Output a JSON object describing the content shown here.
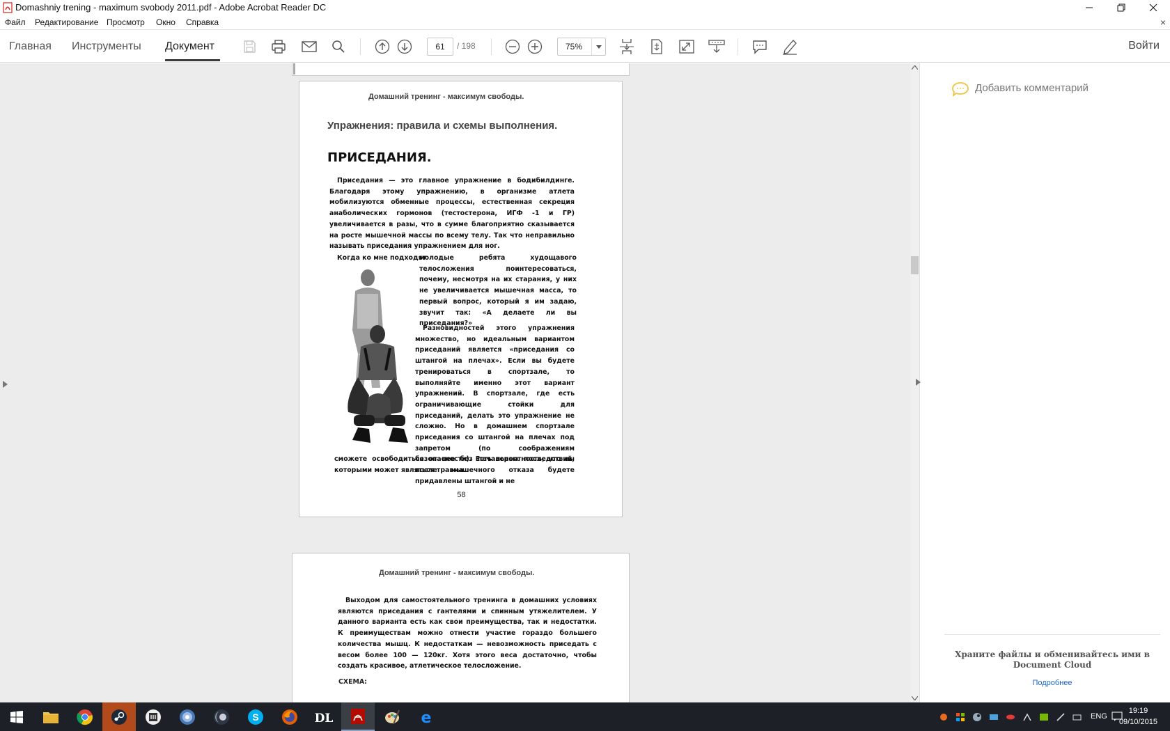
{
  "window": {
    "title": "Domashniy trening - maximum svobody 2011.pdf - Adobe Acrobat Reader DC"
  },
  "menu": [
    "Файл",
    "Редактирование",
    "Просмотр",
    "Окно",
    "Справка"
  ],
  "tabs": {
    "home": "Главная",
    "tools": "Инструменты",
    "document": "Документ",
    "active": "document"
  },
  "toolbar": {
    "current_page": "61",
    "total_pages": "/ 198",
    "zoom": "75%",
    "sign_in": "Войти"
  },
  "page_top": {
    "header": "Домашний тренинг - максимум свободы.",
    "section_title": "Упражнения: правила и схемы выполнения.",
    "exercise_title": "ПРИСЕДАНИЯ.",
    "paragraph1": "Приседания — это главное упражнение в бодибилдинге. Благодаря этому упражнению, в организме атлета мобилизуются обменные процессы, естественная секреция анаболических гормонов (тестостерона, ИГФ -1 и ГР) увеличивается в разы, что в сумме благоприятно сказывается на росте мышечной массы по всему телу. Так что неправильно называть приседания упражнением для ног.",
    "paragraph2_lead": "Когда ко мне подходят",
    "paragraph2": "молодые ребята худощавого телосложения поинтересоваться, почему, несмотря на их старания, у них не увеличивается мышечная масса, то первый вопрос, который я им задаю, звучит так: «А делаете ли вы приседания?»",
    "paragraph3": "Разновидностей этого упражнения множество, но идеальным вариантом приседаний является «приседания со штангой на плечах». Если вы будете тренироваться в спортзале, то выполняйте именно этот вариант упражнений. В спортзале, где есть ограничивающие стойки для приседаний, делать это упражнение не сложно. Но в домашнем спортзале приседания со штангой на плечах под запретом (по соображениям безопасности). Есть вероятность, что вы после мышечного отказа будете придавлены штангой и не",
    "paragraph3_tail": "сможете освободиться от нее без печальных последствий, которыми может являться травма.",
    "page_number": "58"
  },
  "page_bottom": {
    "header": "Домашний тренинг - максимум свободы.",
    "paragraph1": "Выходом для самостоятельного тренинга в домашних условиях являются приседания с гантелями и спинным утяжелителем. У данного варианта есть как свои преимущества, так и недостатки. К преимуществам можно отнести участие гораздо большего количества мышц. К недостаткам — невозможность приседать с весом более 100 — 120кг. Хотя этого веса достаточно, чтобы создать красивое, атлетическое телосложение.",
    "schema_label": "СХЕМА:"
  },
  "right_pane": {
    "add_comment": "Добавить комментарий",
    "cloud_text": "Храните файлы и обменивайтесь ими в Document Cloud",
    "learn_more": "Подробнее"
  },
  "taskbar": {
    "apps": [
      "start",
      "file-explorer",
      "chrome",
      "steam",
      "app-4",
      "app-5",
      "app-6",
      "skype",
      "firefox",
      "dl-app",
      "acrobat",
      "paint-app",
      "edge"
    ],
    "lang": "ENG",
    "time": "19:19",
    "date": "09/10/2015"
  },
  "colors": {
    "acrobat_red": "#d4221c",
    "taskbar": "#1d2026",
    "link": "#1f66c0",
    "comment_icon": "#f3c23c"
  }
}
